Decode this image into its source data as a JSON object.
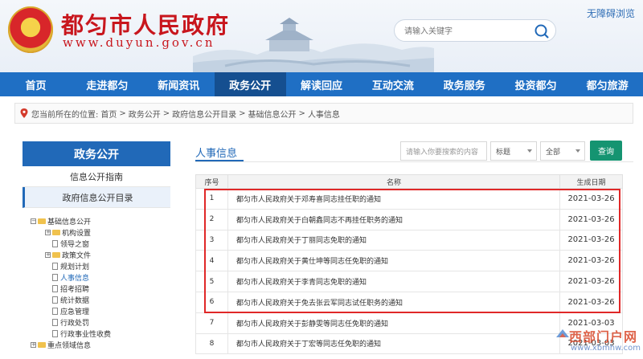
{
  "header": {
    "site_title": "都匀市人民政府",
    "site_domain": "www.duyun.gov.cn",
    "accessible_label": "无障碍浏览",
    "search_placeholder": "请输入关键字"
  },
  "nav": {
    "items": [
      "首页",
      "走进都匀",
      "新闻资讯",
      "政务公开",
      "解读回应",
      "互动交流",
      "政务服务",
      "投资都匀",
      "都匀旅游"
    ],
    "active_index": 3
  },
  "breadcrumb": {
    "prefix": "您当前所在的位置:",
    "items": [
      "首页",
      "政务公开",
      "政府信息公开目录",
      "基础信息公开",
      "人事信息"
    ],
    "separator": ">"
  },
  "sidebar": {
    "title": "政务公开",
    "links": [
      "信息公开指南",
      "政府信息公开目录"
    ],
    "tree": {
      "root": "基础信息公开",
      "children": [
        "机构设置",
        "领导之窗",
        "政策文件",
        "规划计划",
        "人事信息",
        "招考招聘",
        "统计数据",
        "应急管理",
        "行政处罚",
        "行政事业性收费"
      ],
      "next_root": "重点领域信息"
    }
  },
  "main": {
    "tab_label": "人事信息",
    "filter_placeholder": "请输入你要搜索的内容",
    "filter_field": "标题",
    "filter_scope": "全部",
    "query_label": "查询",
    "columns": [
      "序号",
      "名称",
      "生成日期"
    ],
    "rows": [
      {
        "num": "1",
        "title": "都匀市人民政府关于邓寿喜同志挂任职的通知",
        "date": "2021-03-26"
      },
      {
        "num": "2",
        "title": "都匀市人民政府关于白朝鑫同志不再挂任职务的通知",
        "date": "2021-03-26"
      },
      {
        "num": "3",
        "title": "都匀市人民政府关于丁丽同志免职的通知",
        "date": "2021-03-26"
      },
      {
        "num": "4",
        "title": "都匀市人民政府关于黄仕坤等同志任免职的通知",
        "date": "2021-03-26"
      },
      {
        "num": "5",
        "title": "都匀市人民政府关于李青同志免职的通知",
        "date": "2021-03-26"
      },
      {
        "num": "6",
        "title": "都匀市人民政府关于免去张云军同志试任职务的通知",
        "date": "2021-03-26"
      },
      {
        "num": "7",
        "title": "都匀市人民政府关于彭静雯等同志任免职的通知",
        "date": "2021-03-03"
      },
      {
        "num": "8",
        "title": "都匀市人民政府关于丁宏等同志任免职的通知",
        "date": "2021-03-03"
      }
    ]
  },
  "watermark": {
    "cn": "西部门户网",
    "en": "www.xbmhw.com"
  },
  "colors": {
    "brand_red": "#c8161d",
    "nav_blue": "#1f6fc4",
    "nav_active": "#154f90",
    "query_green": "#159471",
    "highlight_red": "#e02828"
  }
}
